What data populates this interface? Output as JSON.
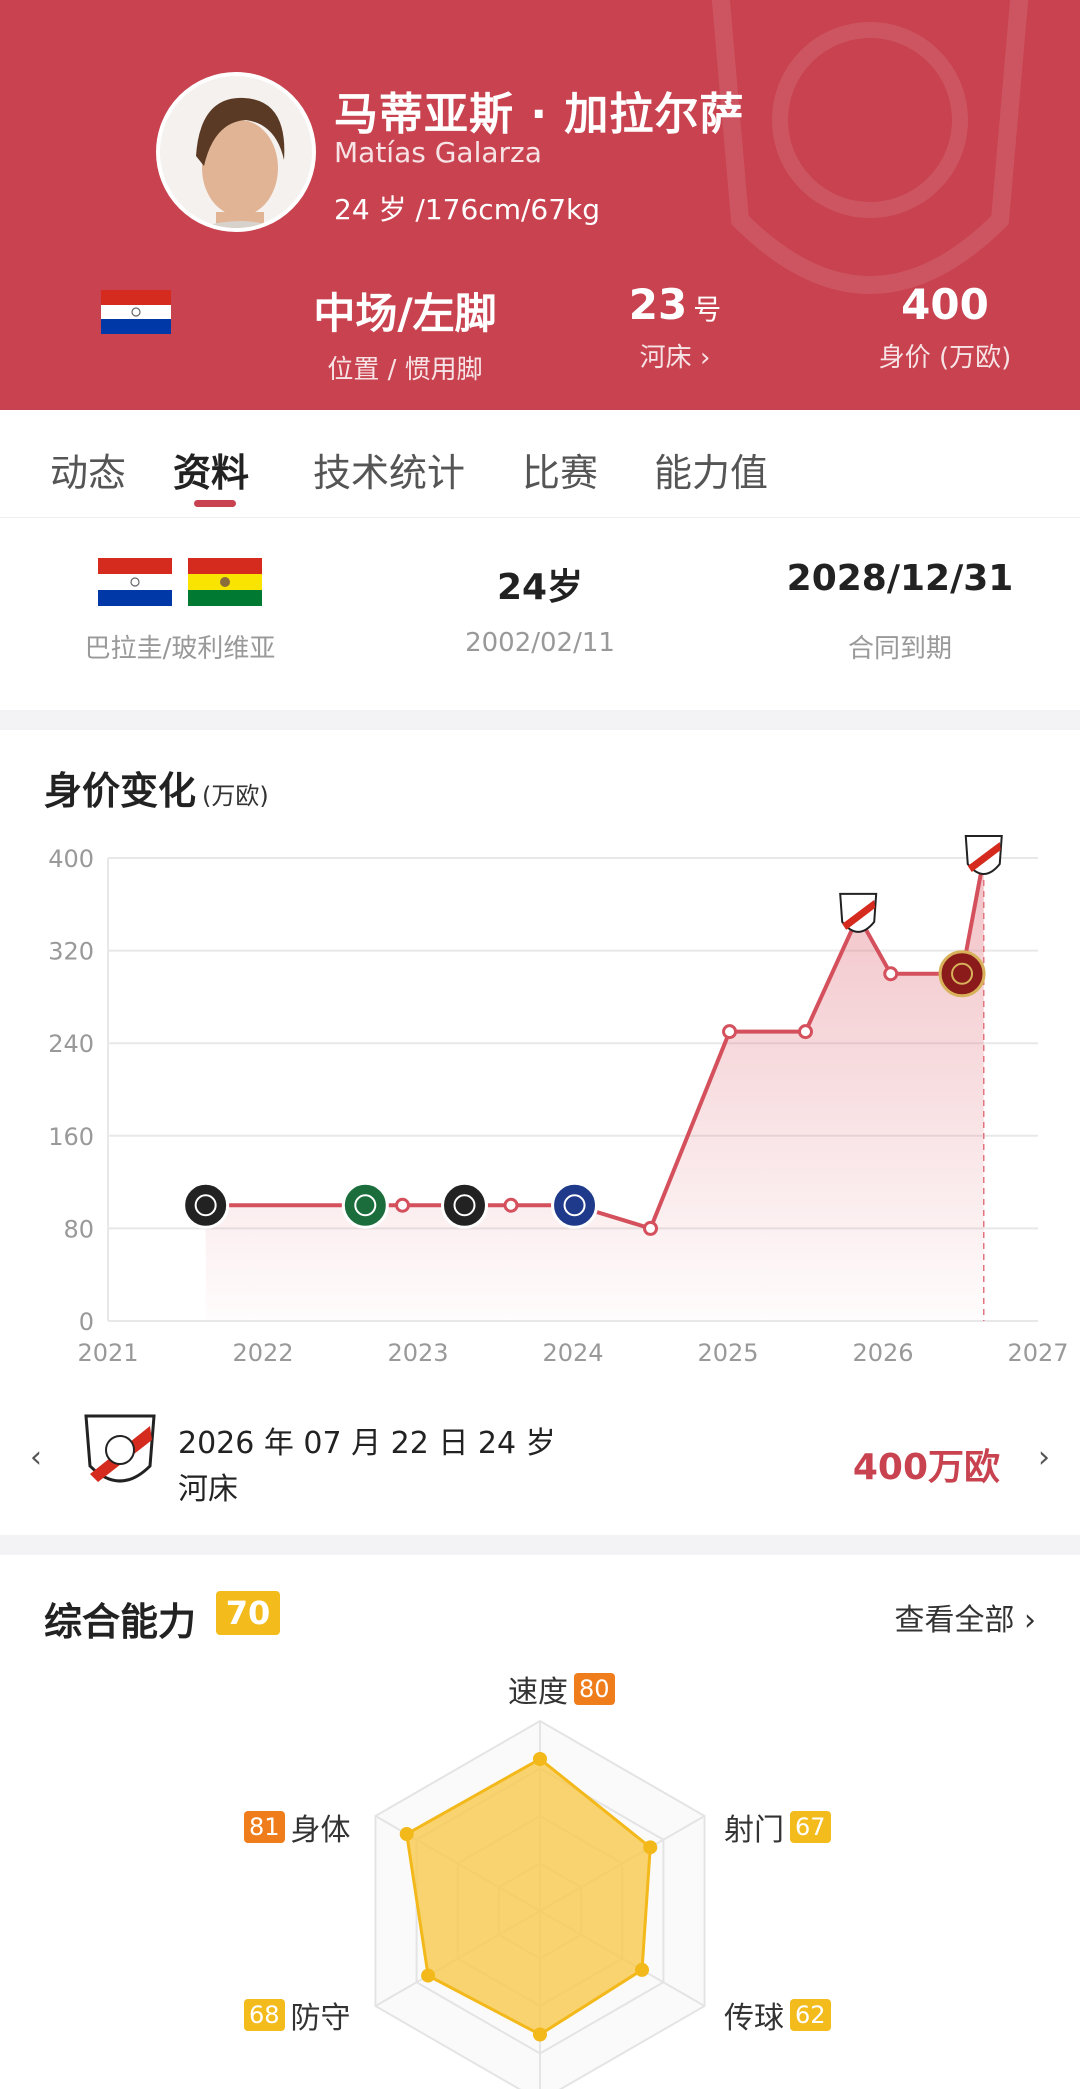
{
  "player": {
    "name_cn": "马蒂亚斯 · 加拉尔萨",
    "name_en": "Matías Galarza",
    "bio": "24 岁 /176cm/67kg"
  },
  "header_stats": {
    "position_value": "中场/左脚",
    "position_label": "位置 / 惯用脚",
    "number_value": "23",
    "number_suffix": "号",
    "club_label": "河床",
    "market_value": "400",
    "market_label": "身价 (万欧)"
  },
  "tabs": [
    {
      "label": "动态"
    },
    {
      "label": "资料"
    },
    {
      "label": "技术统计"
    },
    {
      "label": "比赛"
    },
    {
      "label": "能力值"
    }
  ],
  "active_tab": "资料",
  "info": {
    "nationality": "巴拉圭/玻利维亚",
    "age": "24岁",
    "birthdate": "2002/02/11",
    "contract_end": "2028/12/31",
    "contract_label": "合同到期"
  },
  "value_chart": {
    "title": "身价变化",
    "unit": "(万欧)"
  },
  "chart_data": {
    "type": "line",
    "title": "身价变化",
    "ylabel": "(万欧)",
    "xlabel": "",
    "x_ticks": [
      "2021",
      "2022",
      "2023",
      "2024",
      "2025",
      "2026",
      "2027"
    ],
    "y_ticks": [
      0,
      80,
      160,
      240,
      320,
      400
    ],
    "xlim": [
      2021,
      2027
    ],
    "ylim": [
      0,
      400
    ],
    "grid": true,
    "series": [
      {
        "color": "#d4505c",
        "points": [
          {
            "x": 2021.63,
            "y": 100,
            "club": "olimpia"
          },
          {
            "x": 2022.66,
            "y": 100,
            "club": "coritiba"
          },
          {
            "x": 2022.9,
            "y": 100
          },
          {
            "x": 2023.3,
            "y": 100,
            "club": "vasco"
          },
          {
            "x": 2023.6,
            "y": 100
          },
          {
            "x": 2024.01,
            "y": 100,
            "club": "talleres"
          },
          {
            "x": 2024.5,
            "y": 80
          },
          {
            "x": 2025.01,
            "y": 250
          },
          {
            "x": 2025.5,
            "y": 250
          },
          {
            "x": 2025.84,
            "y": 350,
            "club": "river"
          },
          {
            "x": 2026.05,
            "y": 300
          },
          {
            "x": 2026.51,
            "y": 300,
            "club": "atlanta"
          },
          {
            "x": 2026.65,
            "y": 400,
            "club": "river"
          }
        ]
      }
    ]
  },
  "selected_point": {
    "date_text": "2026 年 07 月 22 日 24 岁",
    "club": "河床",
    "value": "400万欧"
  },
  "ability": {
    "title": "综合能力",
    "overall": "70",
    "view_all": "查看全部",
    "attributes": [
      {
        "name": "速度",
        "value": 80
      },
      {
        "name": "射门",
        "value": 67
      },
      {
        "name": "传球",
        "value": 62
      },
      {
        "name": "防守",
        "value": 68
      },
      {
        "name": "身体",
        "value": 81
      }
    ]
  },
  "colors": {
    "header_red": "#c8424f",
    "accent_red": "#c8424f",
    "ability_yellow": "#f3bb1b",
    "ability_orange": "#f07d1c"
  }
}
